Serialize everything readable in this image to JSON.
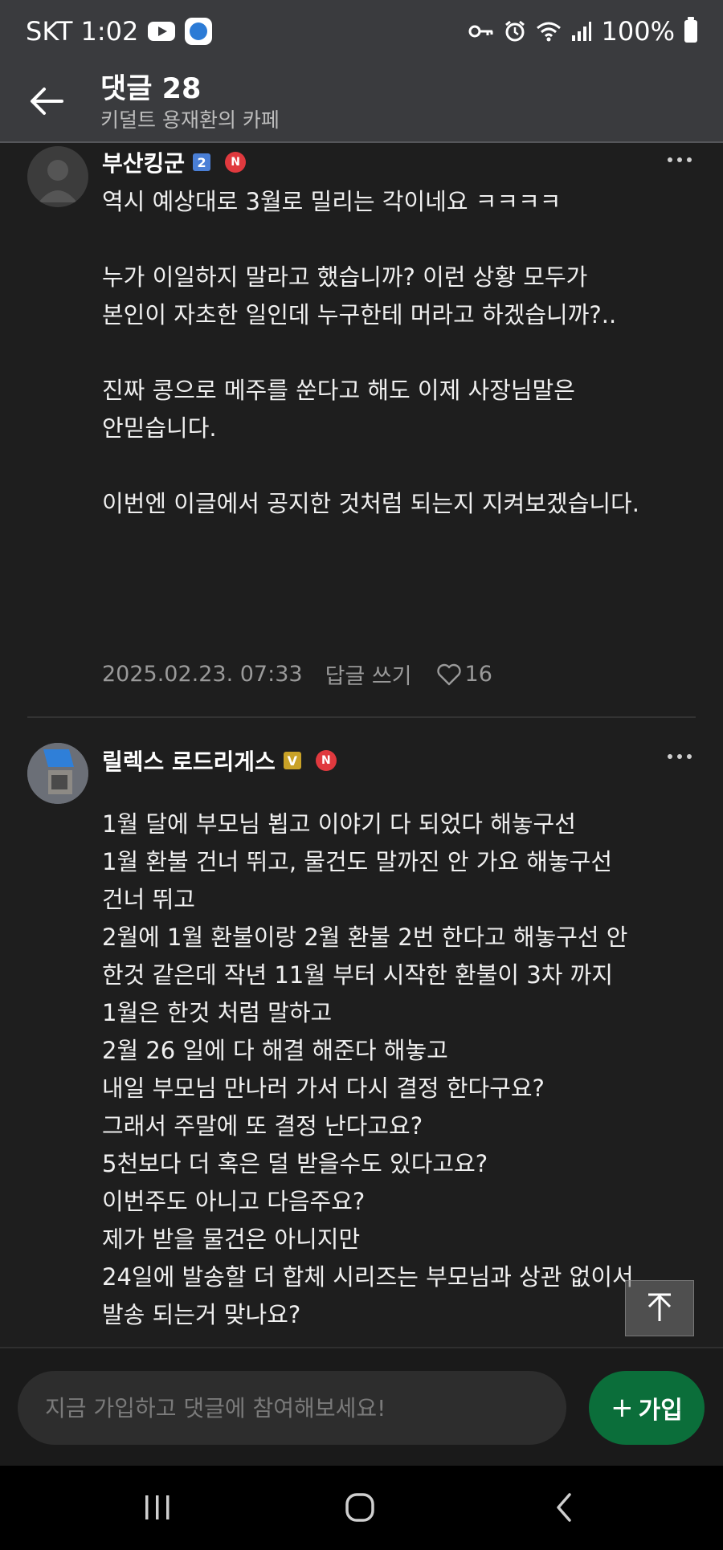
{
  "status_bar": {
    "carrier_time": "SKT 1:02",
    "battery": "100%"
  },
  "header": {
    "title": "댓글 28",
    "subtitle": "키덜트 용재환의 카페"
  },
  "comments": [
    {
      "author": "부산킹군",
      "level_badge": "2",
      "n_badge": "N",
      "lines": [
        "역시 예상대로 3월로 밀리는 각이네요 ㅋㅋㅋㅋ",
        "",
        "누가 이일하지 말라고 했습니까? 이런 상황 모두가",
        "본인이 자초한 일인데 누구한테 머라고 하겠습니까?..",
        "",
        "진짜 콩으로 메주를 쑨다고 해도 이제 사장님말은",
        "안믿습니다.",
        "",
        "이번엔 이글에서 공지한 것처럼 되는지 지켜보겠습니다."
      ],
      "date": "2025.02.23. 07:33",
      "reply_label": "답글 쓰기",
      "likes": "16"
    },
    {
      "author": "릴렉스 로드리게스",
      "level_badge": "V",
      "n_badge": "N",
      "lines": [
        "1월 달에 부모님 뵙고 이야기 다 되었다 해놓구선",
        "1월 환불 건너 뛰고, 물건도 말까진 안 가요 해놓구선",
        "건너 뛰고",
        "2월에 1월 환불이랑 2월 환불 2번 한다고 해놓구선 안",
        "한것 같은데 작년 11월 부터 시작한 환불이 3차 까지",
        "1월은 한것 처럼 말하고",
        "2월 26 일에 다 해결 해준다 해놓고",
        "내일 부모님 만나러 가서 다시 결정 한다구요?",
        "그래서 주말에 또 결정 난다고요?",
        "5천보다 더 혹은 덜 받을수도 있다고요?",
        "이번주도 아니고 다음주요?",
        "제가 받을 물건은 아니지만",
        "24일에 발송할 더 합체 시리즈는 부모님과 상관 없이서",
        "발송 되는거 맞나요?"
      ]
    }
  ],
  "input_bar": {
    "placeholder": "지금 가입하고 댓글에 참여해보세요!",
    "join_label": "가입",
    "join_plus": "+"
  },
  "colors": {
    "background": "#1e1e1e",
    "header": "#3a3b3e",
    "join_button": "#0b6e3a",
    "n_badge": "#e0393e",
    "level2_badge": "#4a7fd6",
    "levelV_badge": "#c9a227"
  }
}
